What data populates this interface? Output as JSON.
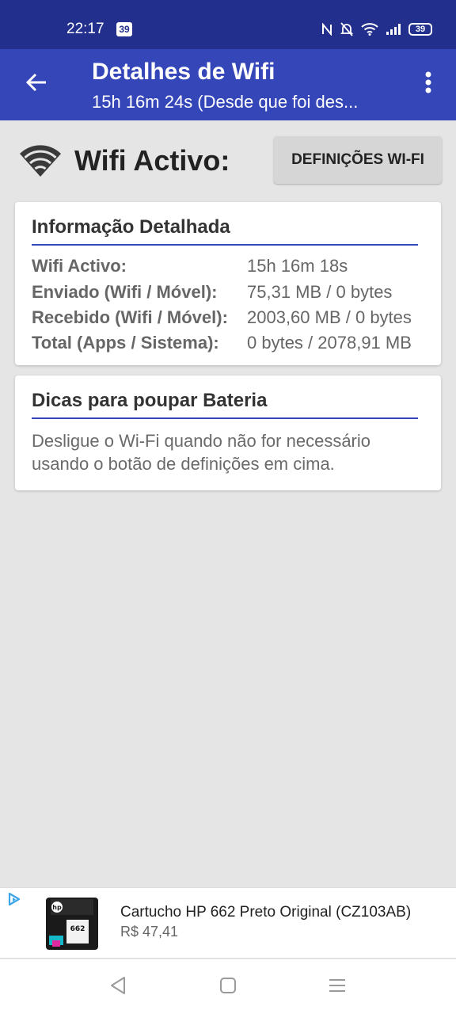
{
  "status_bar": {
    "time": "22:17",
    "badge": "39",
    "battery": "39"
  },
  "app_bar": {
    "title": "Detalhes de Wifi",
    "subtitle": "15h 16m 24s (Desde que foi des..."
  },
  "wifi": {
    "status_label": "Wifi Activo:",
    "settings_button": "DEFINIÇÕES WI-FI"
  },
  "details_card": {
    "title": "Informação Detalhada",
    "rows": [
      {
        "label": "Wifi Activo:",
        "value": "15h 16m 18s"
      },
      {
        "label": "Enviado (Wifi / Móvel):",
        "value": "75,31 MB / 0 bytes"
      },
      {
        "label": "Recebido (Wifi / Móvel):",
        "value": "2003,60 MB / 0 bytes"
      },
      {
        "label": "Total (Apps / Sistema):",
        "value": "0 bytes / 2078,91 MB"
      }
    ]
  },
  "tips_card": {
    "title": "Dicas para poupar Bateria",
    "text": "Desligue o Wi-Fi quando não for necessário usando o botão de definições em cima."
  },
  "ad": {
    "title": "Cartucho HP 662 Preto Original (CZ103AB)",
    "price": "R$ 47,41",
    "product_logo": "hp",
    "product_number": "662"
  },
  "colors": {
    "status_bar": "#222f8c",
    "app_bar": "#3446b8",
    "background": "#e5e5e5"
  }
}
